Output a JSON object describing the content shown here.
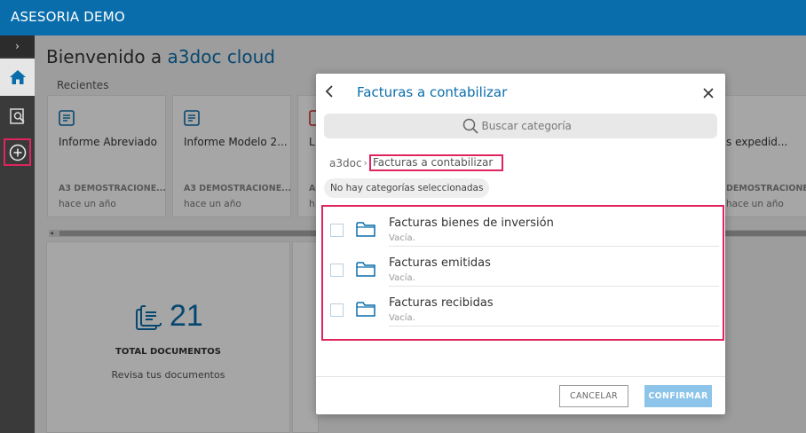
{
  "app": {
    "title": "ASESORIA DEMO"
  },
  "rail": {
    "toggle_icon": "chevron-right"
  },
  "home": {
    "welcome_prefix": "Bienvenido a",
    "welcome_brand": "a3doc cloud",
    "recent_label": "Recientes",
    "cards": [
      {
        "name": "Informe Abreviado",
        "owner": "A3 DEMOSTRACIONE...",
        "time": "hace un año",
        "icon": "document-icon"
      },
      {
        "name": "Informe Modelo 2...",
        "owner": "A3 DEMOSTRACIONE...",
        "time": "hace un año",
        "icon": "document-icon"
      },
      {
        "name": "L",
        "owner": "A",
        "time": "h",
        "icon": "pdf-icon"
      },
      {
        "name": "s expedid...",
        "owner": "DEMOSTRACIONE...",
        "time": "hace un año",
        "icon": "document-icon"
      }
    ],
    "stats": {
      "count": "21",
      "label": "TOTAL DOCUMENTOS",
      "sub": "Revisa tus documentos"
    }
  },
  "modal": {
    "title": "Facturas a contabilizar",
    "search_placeholder": "Buscar categoría",
    "breadcrumb_root": "a3doc",
    "breadcrumb_sep": "›",
    "breadcrumb_current": "Facturas a contabilizar",
    "selection_chip": "No hay categorías seleccionadas",
    "items": [
      {
        "name": "Facturas bienes de inversión",
        "status": "Vacía."
      },
      {
        "name": "Facturas emitidas",
        "status": "Vacía."
      },
      {
        "name": "Facturas recibidas",
        "status": "Vacía."
      }
    ],
    "cancel_label": "CANCELAR",
    "confirm_label": "CONFIRMAR"
  },
  "colors": {
    "brand": "#0a6dab",
    "highlight": "#e0245e",
    "confirm_disabled": "#8cc4ea"
  }
}
